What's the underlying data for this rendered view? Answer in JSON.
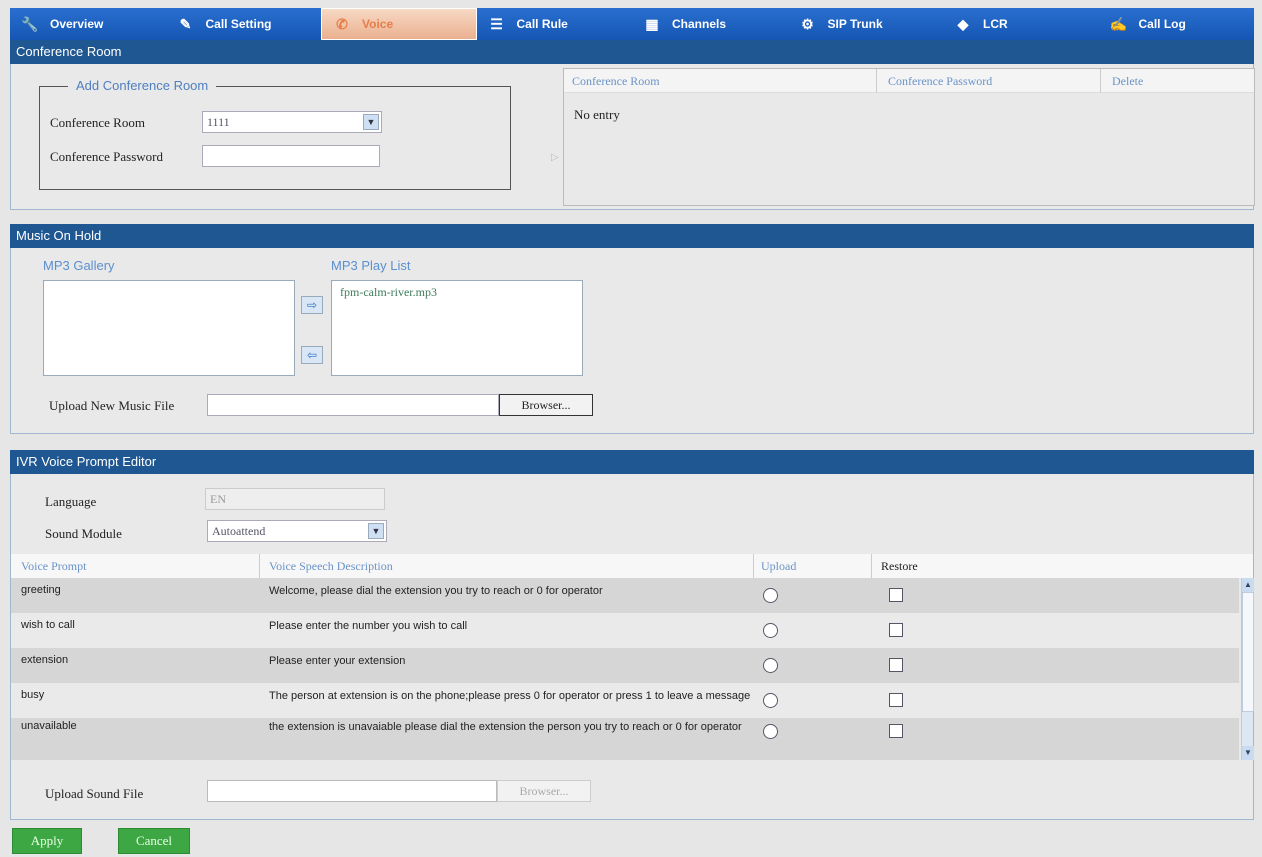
{
  "nav": {
    "tabs": [
      {
        "label": "Overview",
        "icon": "wrench-icon",
        "glyph": "🔧"
      },
      {
        "label": "Call Setting",
        "icon": "pencil-icon",
        "glyph": "✎"
      },
      {
        "label": "Voice",
        "icon": "voice-icon",
        "glyph": "✆",
        "active": true
      },
      {
        "label": "Call Rule",
        "icon": "rule-icon",
        "glyph": "☰"
      },
      {
        "label": "Channels",
        "icon": "channels-icon",
        "glyph": "▦"
      },
      {
        "label": "SIP Trunk",
        "icon": "trunk-icon",
        "glyph": "⚙"
      },
      {
        "label": "LCR",
        "icon": "lcr-icon",
        "glyph": "◆"
      },
      {
        "label": "Call Log",
        "icon": "log-icon",
        "glyph": "✍"
      }
    ]
  },
  "conference": {
    "header": "Conference Room",
    "legend": "Add Conference Room",
    "room_label": "Conference Room",
    "room_value": "1111",
    "password_label": "Conference Password",
    "password_value": "",
    "table": {
      "col_room": "Conference Room",
      "col_password": "Conference Password",
      "col_delete": "Delete",
      "empty_text": "No entry"
    }
  },
  "moh": {
    "header": "Music On Hold",
    "gallery_label": "MP3 Gallery",
    "playlist_label": "MP3 Play List",
    "playlist_items": [
      "fpm-calm-river.mp3"
    ],
    "upload_label": "Upload New Music File",
    "upload_value": "",
    "browse_label": "Browser..."
  },
  "ivr": {
    "header": "IVR Voice Prompt Editor",
    "language_label": "Language",
    "language_value": "EN",
    "module_label": "Sound Module",
    "module_value": "Autoattend",
    "columns": {
      "prompt": "Voice Prompt",
      "description": "Voice Speech Description",
      "upload": "Upload",
      "restore": "Restore"
    },
    "rows": [
      {
        "prompt": "greeting",
        "description": "Welcome, please dial the extension you try to reach or 0 for operator"
      },
      {
        "prompt": "wish to call",
        "description": "Please enter the number you wish to call"
      },
      {
        "prompt": "extension",
        "description": "Please enter your extension"
      },
      {
        "prompt": "busy",
        "description": "The person at extension is on the phone;please press 0 for operator or press 1 to leave a message"
      },
      {
        "prompt": "unavailable",
        "description": "the extension is unavaiable please dial the extension the person you try to reach or 0 for operator"
      }
    ],
    "upload_sound_label": "Upload Sound File",
    "upload_sound_value": "",
    "browse_label": "Browser..."
  },
  "actions": {
    "apply": "Apply",
    "cancel": "Cancel"
  },
  "colors": {
    "nav_bg": "#1556b3",
    "header_bg": "#1f5792",
    "active_tab": "#eab08f",
    "button_green": "#3da843"
  }
}
